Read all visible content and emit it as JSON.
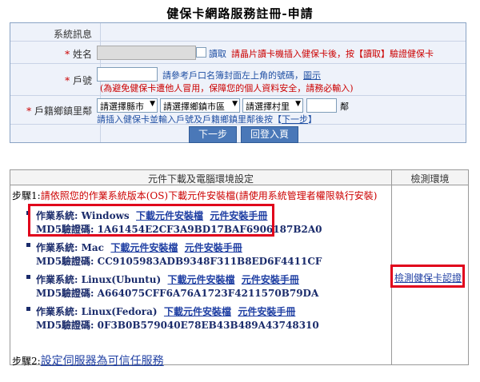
{
  "page_title": "健保卡網路服務註冊-申請",
  "form": {
    "system_msg_label": "系統訊息",
    "name_label": "姓名",
    "name_value": "",
    "read_label": "讀取",
    "name_hint": "請晶片讀卡機插入健保卡後，按【讀取】驗證健保卡",
    "household_label": "戶號",
    "household_value": "",
    "household_hint_prefix": "請參考戶口名簿封面左上角的號碼，",
    "household_hint_link": "圖示",
    "household_warning": "(為避免健保卡遭他人冒用，保障您的個人資料安全，請務必輸入)",
    "address_label": "戶籍鄉鎮里鄰",
    "select_city": "請選擇縣市",
    "select_district": "請選擇鄉鎮市區",
    "select_village": "請選擇村里",
    "neighbor_unit": "鄰",
    "address_hint_prefix": "請插入健保卡並輸入戶號及戶籍鄉鎮里鄰後按【",
    "address_hint_link": "下一步",
    "address_hint_suffix": "】",
    "next_button": "下一步",
    "back_button": "回登入頁"
  },
  "components": {
    "header_left": "元件下載及電腦環境設定",
    "header_right": "檢測環境",
    "step1_prefix": "步驟1:",
    "step1_text": "請依照您的作業系統版本(OS)下載元件安裝檔(請使用系統管理者權限執行安裝)",
    "os_label": "作業系統:",
    "md5_label": "MD5驗證碼:",
    "download_label": "下載元件安裝檔",
    "manual_label": "元件安裝手冊",
    "items": [
      {
        "os": "Windows",
        "md5": "1A61454E2CF3A9BD17BAF6906187B2A0"
      },
      {
        "os": "Mac",
        "md5": "CC9105983ADB9348F311B8ED6F4411CF"
      },
      {
        "os": "Linux(Ubuntu)",
        "md5": "A664075CFF6A76A1723F4211570B79DA"
      },
      {
        "os": "Linux(Fedora)",
        "md5": "0F3B0B579040E78EB43B489A43748310"
      }
    ],
    "check_link": "檢測健保卡認證",
    "step2_prefix": "步驟2:",
    "step2_link": "設定伺服器為可信任服務"
  },
  "colors": {
    "highlight": "#e0001b",
    "form_bg": "#eef2fa",
    "button": "#4a78b8"
  }
}
